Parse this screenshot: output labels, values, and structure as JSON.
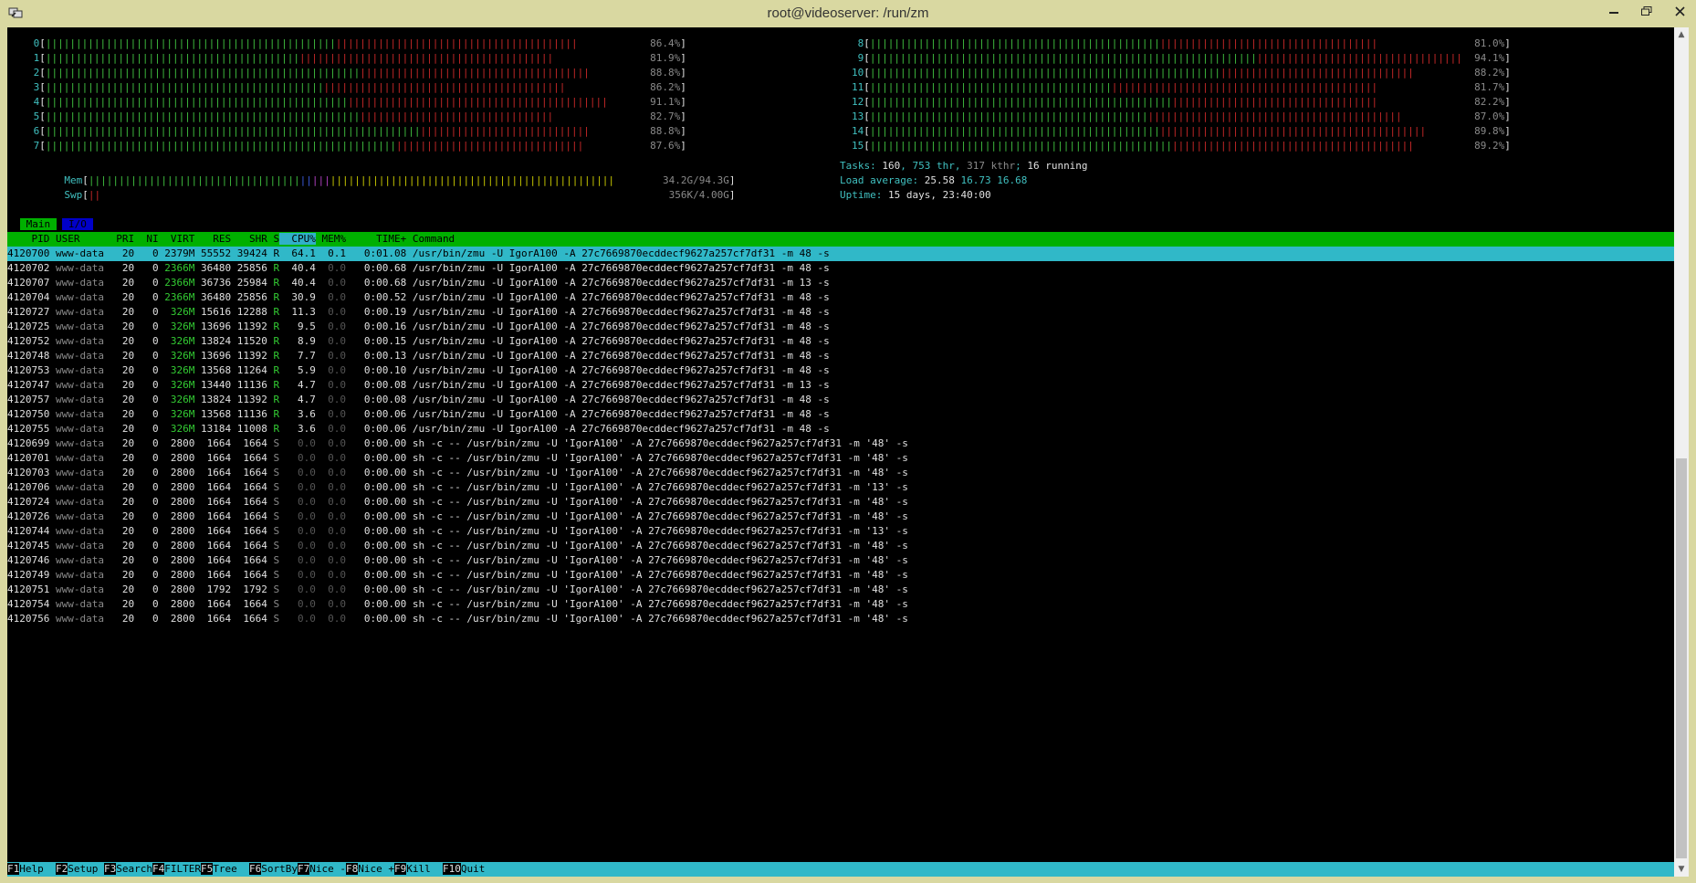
{
  "window": {
    "title": "root@videoserver: /run/zm"
  },
  "cpu_bars": {
    "left": [
      {
        "id": "0",
        "percent": "86.4%",
        "green": 48,
        "red": 40
      },
      {
        "id": "1",
        "percent": "81.9%",
        "green": 42,
        "red": 42
      },
      {
        "id": "2",
        "percent": "88.8%",
        "green": 52,
        "red": 38
      },
      {
        "id": "3",
        "percent": "86.2%",
        "green": 46,
        "red": 40
      },
      {
        "id": "4",
        "percent": "91.1%",
        "green": 50,
        "red": 43
      },
      {
        "id": "5",
        "percent": "82.7%",
        "green": 52,
        "red": 32
      },
      {
        "id": "6",
        "percent": "88.8%",
        "green": 62,
        "red": 28
      },
      {
        "id": "7",
        "percent": "87.6%",
        "green": 58,
        "red": 31
      }
    ],
    "right": [
      {
        "id": "8",
        "percent": "81.0%",
        "green": 48,
        "red": 36
      },
      {
        "id": "9",
        "percent": "94.1%",
        "green": 64,
        "red": 34
      },
      {
        "id": "10",
        "percent": "88.2%",
        "green": 58,
        "red": 32
      },
      {
        "id": "11",
        "percent": "81.7%",
        "green": 40,
        "red": 44
      },
      {
        "id": "12",
        "percent": "82.2%",
        "green": 50,
        "red": 34
      },
      {
        "id": "13",
        "percent": "87.0%",
        "green": 46,
        "red": 42
      },
      {
        "id": "14",
        "percent": "89.8%",
        "green": 48,
        "red": 44
      },
      {
        "id": "15",
        "percent": "89.2%",
        "green": 50,
        "red": 40
      }
    ]
  },
  "mem": {
    "label": "Mem",
    "value": "34.2G/94.3G",
    "green": 35,
    "blue": 2,
    "magenta": 3,
    "yellow": 47
  },
  "swp": {
    "label": "Swp",
    "value": "356K/4.00G",
    "red": 2
  },
  "tasks": {
    "label": "Tasks: ",
    "count": "160",
    "sep1": ", ",
    "thr": "753 thr",
    "sep2": ", ",
    "kthr": "317 kthr",
    "sep3": "; ",
    "running": "16 running"
  },
  "load": {
    "label": "Load average: ",
    "one": "25.58",
    "five": "16.73",
    "fifteen": "16.68"
  },
  "uptime": {
    "label": "Uptime: ",
    "value": "15 days, 23:40:00"
  },
  "tabs": {
    "main": "Main",
    "io": "I/O"
  },
  "header": [
    "PID",
    "USER",
    "PRI",
    "NI",
    "VIRT",
    "RES",
    "SHR",
    "S",
    "CPU%",
    "MEM%",
    "TIME+",
    "Command"
  ],
  "sorted_column": "CPU%",
  "processes": [
    {
      "pid": "4120700",
      "user": "www-data",
      "pri": "20",
      "ni": "0",
      "virt": "2379M",
      "res": "55552",
      "shr": "39424",
      "s": "R",
      "cpu": "64.1",
      "mem": "0.1",
      "time": "0:01.08",
      "cmd": "/usr/bin/zmu -U IgorA100 -A 27c7669870ecddecf9627a257cf7df31 -m 48 -s"
    },
    {
      "pid": "4120702",
      "user": "www-data",
      "pri": "20",
      "ni": "0",
      "virt": "2366M",
      "res": "36480",
      "shr": "25856",
      "s": "R",
      "cpu": "40.4",
      "mem": "0.0",
      "time": "0:00.68",
      "cmd": "/usr/bin/zmu -U IgorA100 -A 27c7669870ecddecf9627a257cf7df31 -m 48 -s"
    },
    {
      "pid": "4120707",
      "user": "www-data",
      "pri": "20",
      "ni": "0",
      "virt": "2366M",
      "res": "36736",
      "shr": "25984",
      "s": "R",
      "cpu": "40.4",
      "mem": "0.0",
      "time": "0:00.68",
      "cmd": "/usr/bin/zmu -U IgorA100 -A 27c7669870ecddecf9627a257cf7df31 -m 13 -s"
    },
    {
      "pid": "4120704",
      "user": "www-data",
      "pri": "20",
      "ni": "0",
      "virt": "2366M",
      "res": "36480",
      "shr": "25856",
      "s": "R",
      "cpu": "30.9",
      "mem": "0.0",
      "time": "0:00.52",
      "cmd": "/usr/bin/zmu -U IgorA100 -A 27c7669870ecddecf9627a257cf7df31 -m 48 -s"
    },
    {
      "pid": "4120727",
      "user": "www-data",
      "pri": "20",
      "ni": "0",
      "virt": "326M",
      "res": "15616",
      "shr": "12288",
      "s": "R",
      "cpu": "11.3",
      "mem": "0.0",
      "time": "0:00.19",
      "cmd": "/usr/bin/zmu -U IgorA100 -A 27c7669870ecddecf9627a257cf7df31 -m 48 -s"
    },
    {
      "pid": "4120725",
      "user": "www-data",
      "pri": "20",
      "ni": "0",
      "virt": "326M",
      "res": "13696",
      "shr": "11392",
      "s": "R",
      "cpu": "9.5",
      "mem": "0.0",
      "time": "0:00.16",
      "cmd": "/usr/bin/zmu -U IgorA100 -A 27c7669870ecddecf9627a257cf7df31 -m 48 -s"
    },
    {
      "pid": "4120752",
      "user": "www-data",
      "pri": "20",
      "ni": "0",
      "virt": "326M",
      "res": "13824",
      "shr": "11520",
      "s": "R",
      "cpu": "8.9",
      "mem": "0.0",
      "time": "0:00.15",
      "cmd": "/usr/bin/zmu -U IgorA100 -A 27c7669870ecddecf9627a257cf7df31 -m 48 -s"
    },
    {
      "pid": "4120748",
      "user": "www-data",
      "pri": "20",
      "ni": "0",
      "virt": "326M",
      "res": "13696",
      "shr": "11392",
      "s": "R",
      "cpu": "7.7",
      "mem": "0.0",
      "time": "0:00.13",
      "cmd": "/usr/bin/zmu -U IgorA100 -A 27c7669870ecddecf9627a257cf7df31 -m 48 -s"
    },
    {
      "pid": "4120753",
      "user": "www-data",
      "pri": "20",
      "ni": "0",
      "virt": "326M",
      "res": "13568",
      "shr": "11264",
      "s": "R",
      "cpu": "5.9",
      "mem": "0.0",
      "time": "0:00.10",
      "cmd": "/usr/bin/zmu -U IgorA100 -A 27c7669870ecddecf9627a257cf7df31 -m 48 -s"
    },
    {
      "pid": "4120747",
      "user": "www-data",
      "pri": "20",
      "ni": "0",
      "virt": "326M",
      "res": "13440",
      "shr": "11136",
      "s": "R",
      "cpu": "4.7",
      "mem": "0.0",
      "time": "0:00.08",
      "cmd": "/usr/bin/zmu -U IgorA100 -A 27c7669870ecddecf9627a257cf7df31 -m 13 -s"
    },
    {
      "pid": "4120757",
      "user": "www-data",
      "pri": "20",
      "ni": "0",
      "virt": "326M",
      "res": "13824",
      "shr": "11392",
      "s": "R",
      "cpu": "4.7",
      "mem": "0.0",
      "time": "0:00.08",
      "cmd": "/usr/bin/zmu -U IgorA100 -A 27c7669870ecddecf9627a257cf7df31 -m 48 -s"
    },
    {
      "pid": "4120750",
      "user": "www-data",
      "pri": "20",
      "ni": "0",
      "virt": "326M",
      "res": "13568",
      "shr": "11136",
      "s": "R",
      "cpu": "3.6",
      "mem": "0.0",
      "time": "0:00.06",
      "cmd": "/usr/bin/zmu -U IgorA100 -A 27c7669870ecddecf9627a257cf7df31 -m 48 -s"
    },
    {
      "pid": "4120755",
      "user": "www-data",
      "pri": "20",
      "ni": "0",
      "virt": "326M",
      "res": "13184",
      "shr": "11008",
      "s": "R",
      "cpu": "3.6",
      "mem": "0.0",
      "time": "0:00.06",
      "cmd": "/usr/bin/zmu -U IgorA100 -A 27c7669870ecddecf9627a257cf7df31 -m 48 -s"
    },
    {
      "pid": "4120699",
      "user": "www-data",
      "pri": "20",
      "ni": "0",
      "virt": "2800",
      "res": "1664",
      "shr": "1664",
      "s": "S",
      "cpu": "0.0",
      "mem": "0.0",
      "time": "0:00.00",
      "cmd": "sh -c -- /usr/bin/zmu -U 'IgorA100' -A 27c7669870ecddecf9627a257cf7df31 -m '48' -s"
    },
    {
      "pid": "4120701",
      "user": "www-data",
      "pri": "20",
      "ni": "0",
      "virt": "2800",
      "res": "1664",
      "shr": "1664",
      "s": "S",
      "cpu": "0.0",
      "mem": "0.0",
      "time": "0:00.00",
      "cmd": "sh -c -- /usr/bin/zmu -U 'IgorA100' -A 27c7669870ecddecf9627a257cf7df31 -m '48' -s"
    },
    {
      "pid": "4120703",
      "user": "www-data",
      "pri": "20",
      "ni": "0",
      "virt": "2800",
      "res": "1664",
      "shr": "1664",
      "s": "S",
      "cpu": "0.0",
      "mem": "0.0",
      "time": "0:00.00",
      "cmd": "sh -c -- /usr/bin/zmu -U 'IgorA100' -A 27c7669870ecddecf9627a257cf7df31 -m '48' -s"
    },
    {
      "pid": "4120706",
      "user": "www-data",
      "pri": "20",
      "ni": "0",
      "virt": "2800",
      "res": "1664",
      "shr": "1664",
      "s": "S",
      "cpu": "0.0",
      "mem": "0.0",
      "time": "0:00.00",
      "cmd": "sh -c -- /usr/bin/zmu -U 'IgorA100' -A 27c7669870ecddecf9627a257cf7df31 -m '13' -s"
    },
    {
      "pid": "4120724",
      "user": "www-data",
      "pri": "20",
      "ni": "0",
      "virt": "2800",
      "res": "1664",
      "shr": "1664",
      "s": "S",
      "cpu": "0.0",
      "mem": "0.0",
      "time": "0:00.00",
      "cmd": "sh -c -- /usr/bin/zmu -U 'IgorA100' -A 27c7669870ecddecf9627a257cf7df31 -m '48' -s"
    },
    {
      "pid": "4120726",
      "user": "www-data",
      "pri": "20",
      "ni": "0",
      "virt": "2800",
      "res": "1664",
      "shr": "1664",
      "s": "S",
      "cpu": "0.0",
      "mem": "0.0",
      "time": "0:00.00",
      "cmd": "sh -c -- /usr/bin/zmu -U 'IgorA100' -A 27c7669870ecddecf9627a257cf7df31 -m '48' -s"
    },
    {
      "pid": "4120744",
      "user": "www-data",
      "pri": "20",
      "ni": "0",
      "virt": "2800",
      "res": "1664",
      "shr": "1664",
      "s": "S",
      "cpu": "0.0",
      "mem": "0.0",
      "time": "0:00.00",
      "cmd": "sh -c -- /usr/bin/zmu -U 'IgorA100' -A 27c7669870ecddecf9627a257cf7df31 -m '13' -s"
    },
    {
      "pid": "4120745",
      "user": "www-data",
      "pri": "20",
      "ni": "0",
      "virt": "2800",
      "res": "1664",
      "shr": "1664",
      "s": "S",
      "cpu": "0.0",
      "mem": "0.0",
      "time": "0:00.00",
      "cmd": "sh -c -- /usr/bin/zmu -U 'IgorA100' -A 27c7669870ecddecf9627a257cf7df31 -m '48' -s"
    },
    {
      "pid": "4120746",
      "user": "www-data",
      "pri": "20",
      "ni": "0",
      "virt": "2800",
      "res": "1664",
      "shr": "1664",
      "s": "S",
      "cpu": "0.0",
      "mem": "0.0",
      "time": "0:00.00",
      "cmd": "sh -c -- /usr/bin/zmu -U 'IgorA100' -A 27c7669870ecddecf9627a257cf7df31 -m '48' -s"
    },
    {
      "pid": "4120749",
      "user": "www-data",
      "pri": "20",
      "ni": "0",
      "virt": "2800",
      "res": "1664",
      "shr": "1664",
      "s": "S",
      "cpu": "0.0",
      "mem": "0.0",
      "time": "0:00.00",
      "cmd": "sh -c -- /usr/bin/zmu -U 'IgorA100' -A 27c7669870ecddecf9627a257cf7df31 -m '48' -s"
    },
    {
      "pid": "4120751",
      "user": "www-data",
      "pri": "20",
      "ni": "0",
      "virt": "2800",
      "res": "1792",
      "shr": "1792",
      "s": "S",
      "cpu": "0.0",
      "mem": "0.0",
      "time": "0:00.00",
      "cmd": "sh -c -- /usr/bin/zmu -U 'IgorA100' -A 27c7669870ecddecf9627a257cf7df31 -m '48' -s"
    },
    {
      "pid": "4120754",
      "user": "www-data",
      "pri": "20",
      "ni": "0",
      "virt": "2800",
      "res": "1664",
      "shr": "1664",
      "s": "S",
      "cpu": "0.0",
      "mem": "0.0",
      "time": "0:00.00",
      "cmd": "sh -c -- /usr/bin/zmu -U 'IgorA100' -A 27c7669870ecddecf9627a257cf7df31 -m '48' -s"
    },
    {
      "pid": "4120756",
      "user": "www-data",
      "pri": "20",
      "ni": "0",
      "virt": "2800",
      "res": "1664",
      "shr": "1664",
      "s": "S",
      "cpu": "0.0",
      "mem": "0.0",
      "time": "0:00.00",
      "cmd": "sh -c -- /usr/bin/zmu -U 'IgorA100' -A 27c7669870ecddecf9627a257cf7df31 -m '48' -s"
    }
  ],
  "fkeys": [
    {
      "key": "F1",
      "label": "Help  "
    },
    {
      "key": "F2",
      "label": "Setup "
    },
    {
      "key": "F3",
      "label": "Search"
    },
    {
      "key": "F4",
      "label": "FILTER"
    },
    {
      "key": "F5",
      "label": "Tree  "
    },
    {
      "key": "F6",
      "label": "SortBy"
    },
    {
      "key": "F7",
      "label": "Nice -"
    },
    {
      "key": "F8",
      "label": "Nice +"
    },
    {
      "key": "F9",
      "label": "Kill  "
    },
    {
      "key": "F10",
      "label": "Quit  "
    }
  ],
  "colors": {
    "titlebar": "#d9d8a1",
    "green": "#3fbf3f",
    "red": "#c62828",
    "cyan": "#30b8c8",
    "header": "#00b000",
    "yellow": "#c8c800"
  }
}
